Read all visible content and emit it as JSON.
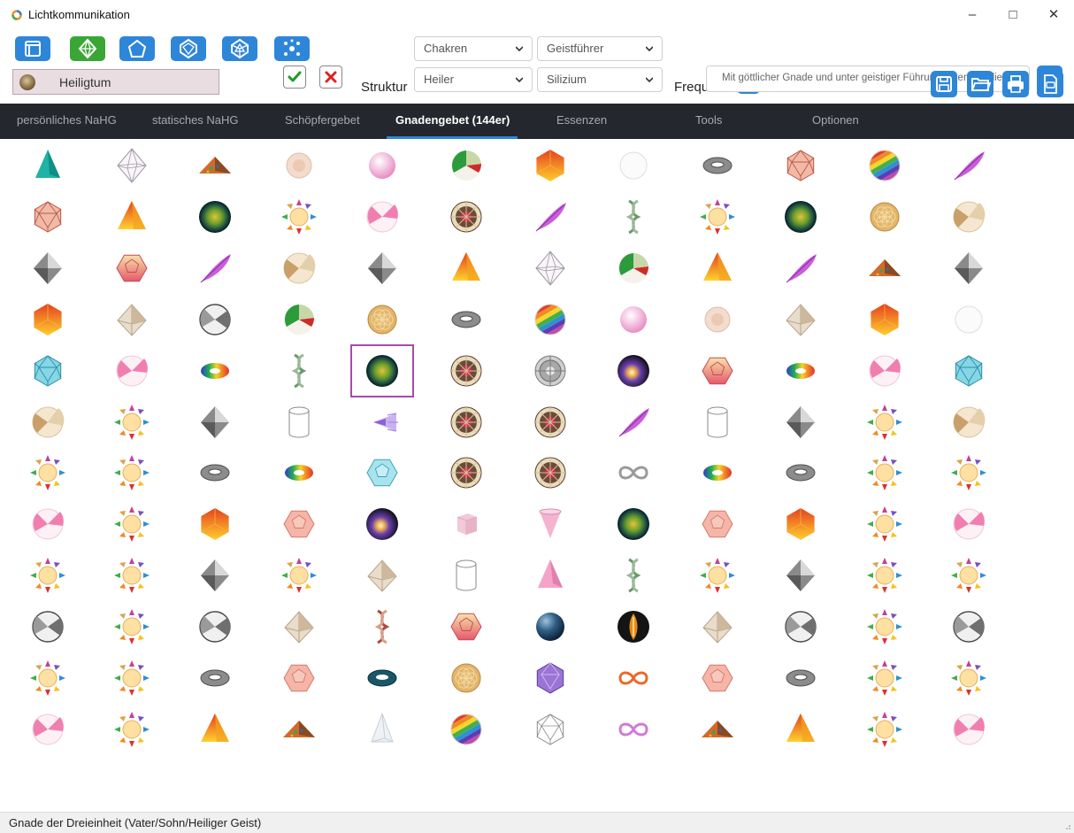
{
  "window": {
    "title": "Lichtkommunikation",
    "minimize": "–",
    "maximize": "□",
    "close": "✕"
  },
  "toolbar": {
    "heiligtum": "Heiligtum",
    "struktur_label": "Struktur",
    "frequenz_label": "Frequenz",
    "select_chakren": "Chakren",
    "select_geistfuehrer": "Geistführer",
    "select_heiler": "Heiler",
    "select_silizium": "Silizium",
    "search_placeholder": "Mit göttlicher Gnade und unter geistiger Führung erkennen die",
    "left_buttons": [
      "window-icon",
      "diamond-icon",
      "pentagon-icon",
      "gem-icon",
      "crystal-icon",
      "network-icon"
    ],
    "right_buttons": [
      "save-icon",
      "folder-icon",
      "print-icon",
      "pdf-icon"
    ]
  },
  "tabs": [
    {
      "label": "persönliches NaHG",
      "active": false
    },
    {
      "label": "statisches NaHG",
      "active": false
    },
    {
      "label": "Schöpfergebet",
      "active": false
    },
    {
      "label": "Gnadengebet (144er)",
      "active": true
    },
    {
      "label": "Essenzen",
      "active": false
    },
    {
      "label": "Tools",
      "active": false
    },
    {
      "label": "Optionen",
      "active": false
    }
  ],
  "grid": {
    "selected_row": 4,
    "selected_col": 4,
    "rows": [
      [
        "tetrahedron-teal",
        "octahedron-wire",
        "pyramid-orgonite",
        "shell-beige",
        "sphere-pink",
        "beachball-green",
        "hexagon-orange",
        "sphere-white",
        "torus-gray",
        "icosahedron-red",
        "beachball-rainbow",
        "feather-purple"
      ],
      [
        "icosahedron-red",
        "pyramid-orange",
        "orb-green",
        "sun-chakra",
        "beachball-pink",
        "mandala-brown",
        "feather-purple",
        "dna-green",
        "sun-chakra",
        "orb-green",
        "flower-of-life",
        "beachball-tan"
      ],
      [
        "diamond-gray",
        "dodecahedron-pink",
        "feather-purple",
        "beachball-tan",
        "diamond-gray",
        "pyramid-orange",
        "octahedron-wire",
        "beachball-green",
        "pyramid-orange",
        "feather-purple",
        "pyramid-orgonite",
        "diamond-gray"
      ],
      [
        "hexagon-orange",
        "octahedron-beige",
        "beachball-gray",
        "beachball-green",
        "flower-of-life",
        "torus-gray",
        "beachball-rainbow",
        "sphere-pink",
        "shell-beige",
        "octahedron-beige",
        "hexagon-orange",
        "sphere-white"
      ],
      [
        "icosahedron-teal",
        "beachball-pink",
        "mobius-rainbow",
        "dna-green",
        "orb-green",
        "mandala-brown",
        "mandala-gray",
        "orb-dark",
        "dodecahedron-pink",
        "mobius-rainbow",
        "beachball-pink",
        "icosahedron-teal"
      ],
      [
        "beachball-tan",
        "sun-chakra",
        "diamond-gray",
        "cylinder-white",
        "comet-purple",
        "mandala-brown",
        "mandala-brown",
        "feather-purple",
        "cylinder-white",
        "diamond-gray",
        "sun-chakra",
        "beachball-tan"
      ],
      [
        "sun-chakra",
        "sun-chakra",
        "torus-gray",
        "mobius-rainbow",
        "dodecahedron-teal",
        "mandala-brown",
        "mandala-brown",
        "infinity-silver",
        "mobius-rainbow",
        "torus-gray",
        "sun-chakra",
        "sun-chakra"
      ],
      [
        "beachball-pink",
        "sun-chakra",
        "hexagon-orange",
        "dodecahedron-salmon",
        "orb-dark",
        "cube-pink",
        "cone-pink",
        "orb-green",
        "dodecahedron-salmon",
        "hexagon-orange",
        "sun-chakra",
        "beachball-pink"
      ],
      [
        "sun-chakra",
        "sun-chakra",
        "diamond-gray",
        "sun-chakra",
        "octahedron-beige",
        "cylinder-white",
        "tetrahedron-pink",
        "dna-green",
        "sun-chakra",
        "diamond-gray",
        "sun-chakra",
        "sun-chakra"
      ],
      [
        "beachball-gray",
        "sun-chakra",
        "beachball-gray",
        "octahedron-beige",
        "dna-red",
        "dodecahedron-pink",
        "sphere-navy",
        "seed-black",
        "octahedron-beige",
        "beachball-gray",
        "sun-chakra",
        "beachball-gray"
      ],
      [
        "sun-chakra",
        "sun-chakra",
        "torus-gray",
        "dodecahedron-salmon",
        "torus-teal",
        "flower-of-life",
        "icosahedron-purple",
        "infinity-orange",
        "dodecahedron-salmon",
        "torus-gray",
        "sun-chakra",
        "sun-chakra"
      ],
      [
        "beachball-pink",
        "sun-chakra",
        "pyramid-orange",
        "pyramid-orgonite",
        "tetrahedron-white",
        "beachball-rainbow",
        "icosahedron-wire",
        "infinity-pink",
        "pyramid-orgonite",
        "pyramid-orange",
        "sun-chakra",
        "beachball-pink"
      ]
    ]
  },
  "status": {
    "text": "Gnade der Dreieinheit (Vater/Sohn/Heiliger Geist)"
  },
  "colors": {
    "accent": "#2e86d9",
    "tabbar": "#24282e",
    "selection": "#a64ca6",
    "heiligtum_bg": "#e9dde1"
  }
}
